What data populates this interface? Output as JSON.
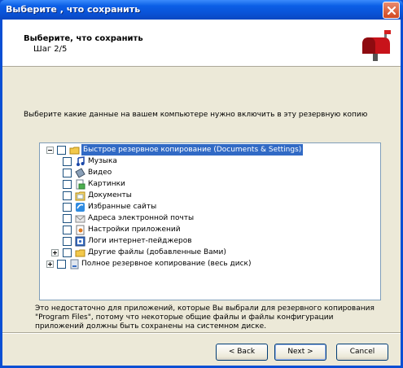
{
  "window": {
    "title": "Выберите , что сохранить"
  },
  "header": {
    "title": "Выберите, что сохранить",
    "step": "Шаг 2/5"
  },
  "instruction": "Выберите какие данные на вашем компьютере нужно включить в эту резервную копию",
  "tree": {
    "quick_backup": "Быстрое резервное копирование (Documents & Settings)",
    "items": [
      {
        "label": "Музыка",
        "icon": "music-icon"
      },
      {
        "label": "Видео",
        "icon": "video-icon"
      },
      {
        "label": "Картинки",
        "icon": "pictures-icon"
      },
      {
        "label": "Документы",
        "icon": "documents-icon"
      },
      {
        "label": "Избранные сайты",
        "icon": "favorites-icon"
      },
      {
        "label": "Адреса электронной почты",
        "icon": "email-icon"
      },
      {
        "label": "Настройки приложений",
        "icon": "app-settings-icon"
      },
      {
        "label": "Логи интернет-пейджеров",
        "icon": "messenger-logs-icon"
      },
      {
        "label": "Другие файлы (добавленные Вами)",
        "icon": "folder-icon"
      }
    ],
    "full_backup": "Полное резервное копирование (весь диск)"
  },
  "note": "Это недостаточно для приложений, которые Вы выбрали для резервного копирования \"Program Files\", потому что некоторые общие файлы и файлы конфигурации приложений должны быть сохранены на системном диске.",
  "buttons": {
    "back": "< Back",
    "next": "Next >",
    "cancel": "Cancel"
  },
  "colors": {
    "titlebar": "#0a52d6",
    "selection": "#316ac5",
    "dialog_bg": "#ece9d8"
  }
}
